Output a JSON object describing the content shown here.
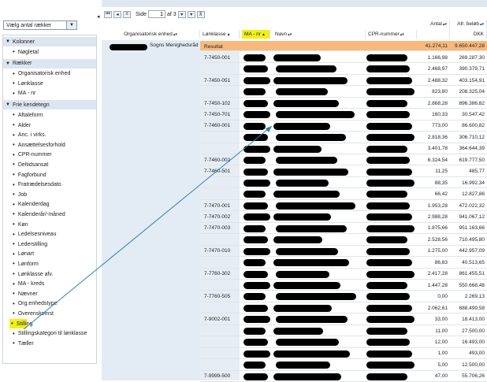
{
  "sidebar": {
    "select_label": "Vælg antal rækker",
    "sections": [
      {
        "label": "Kolonner",
        "items": [
          "Nøgletal"
        ]
      },
      {
        "label": "Rækker",
        "items": [
          "Organisatorisk enhed",
          "Lønklasse",
          "MA - nr"
        ]
      },
      {
        "label": "Frie kendetegn",
        "items": [
          "Aftaleform",
          "Alder",
          "Anc. i virks.",
          "Ansættelsesforhold",
          "CPR-nummer",
          "Deltidsansat",
          "Fagforbund",
          "Fratrædelsesdato",
          "Job",
          "Kalenderdag",
          "Kalenderår/-måned",
          "Køn",
          "Ledelsesniveau",
          "Lederstilling",
          "Lønart",
          "Lønform",
          "Lønklasse afv.",
          "MA - kreds",
          "Nævner",
          "Org.enhedstype",
          "Overenskomst",
          "Stilling",
          "Stillingskategori til lønklasse",
          "Tæller"
        ]
      }
    ],
    "highlighted_item": "Stilling"
  },
  "pager": {
    "label_side": "Side",
    "page": "1",
    "of_label": "af 3"
  },
  "headers": {
    "org": "Organisatorisk enhed",
    "lonklasse": "Lønklasse",
    "manr": "MA - nr",
    "navn": "Navn",
    "cpr": "CPR-nummer",
    "antal": "Antal",
    "afr": "Afr. beløb",
    "unit": "DKK",
    "sort_glyph": "▲",
    "menu_glyph": "▴▾"
  },
  "org_value": "Sogns Menighedsråd",
  "result_row": {
    "label": "Resultat",
    "antal": "41.274,11",
    "belob": "9.650.447,28"
  },
  "rows": [
    {
      "lk": "7-7450-001",
      "antal": "1.166,98",
      "belob": "269.287,30"
    },
    {
      "lk": "",
      "antal": "2.468,97",
      "belob": "390.379,71"
    },
    {
      "lk": "7-7450-051",
      "antal": "2.488,32",
      "belob": "403.154,91"
    },
    {
      "lk": "",
      "antal": "823,80",
      "belob": "208.325,04"
    },
    {
      "lk": "7-7450-102",
      "antal": "2.868,28",
      "belob": "896.386,82"
    },
    {
      "lk": "7-7450-701",
      "antal": "160,33",
      "belob": "30.547,42"
    },
    {
      "lk": "7-7460-001",
      "antal": "773,00",
      "belob": "86.600,82"
    },
    {
      "lk": "",
      "antal": "2.818,36",
      "belob": "306.710,12"
    },
    {
      "lk": "",
      "antal": "3.401,78",
      "belob": "364.644,39"
    },
    {
      "lk": "7-7460-002",
      "antal": "6.324,54",
      "belob": "619.777,50"
    },
    {
      "lk": "7-7460-501",
      "antal": "11,25",
      "belob": "485,77"
    },
    {
      "lk": "",
      "antal": "88,35",
      "belob": "16.992,34"
    },
    {
      "lk": "",
      "antal": "66,42",
      "belob": "12.827,86"
    },
    {
      "lk": "7-7470-001",
      "antal": "1.953,28",
      "belob": "472.022,32"
    },
    {
      "lk": "7-7470-002",
      "antal": "2.988,28",
      "belob": "941.067,12"
    },
    {
      "lk": "7-7470-003",
      "antal": "1.875,66",
      "belob": "951.163,66"
    },
    {
      "lk": "",
      "antal": "2.528,56",
      "belob": "710.495,80"
    },
    {
      "lk": "7-7470-010",
      "antal": "1.275,00",
      "belob": "442.957,09"
    },
    {
      "lk": "",
      "antal": "86,83",
      "belob": "40.513,65"
    },
    {
      "lk": "7-7760-302",
      "antal": "2.417,28",
      "belob": "861.455,51"
    },
    {
      "lk": "",
      "antal": "1.447,28",
      "belob": "550.668,48"
    },
    {
      "lk": "7-7760-505",
      "antal": "0,00",
      "belob": "2.269,13"
    },
    {
      "lk": "",
      "antal": "2.062,61",
      "belob": "688.499,58"
    },
    {
      "lk": "7-9002-001",
      "antal": "33,00",
      "belob": "18.413,00"
    },
    {
      "lk": "",
      "antal": "11,00",
      "belob": "27.500,00"
    },
    {
      "lk": "",
      "antal": "12,00",
      "belob": "16.493,00"
    },
    {
      "lk": "",
      "antal": "1,00",
      "belob": "493,00"
    },
    {
      "lk": "",
      "antal": "5,00",
      "belob": "12.500,00"
    },
    {
      "lk": "7-9999-500",
      "antal": "47,00",
      "belob": "55.706,26"
    }
  ],
  "colors": {
    "result_bg": "#f9b97c",
    "highlight": "#f2f016",
    "arrow": "#2f7fb5"
  }
}
